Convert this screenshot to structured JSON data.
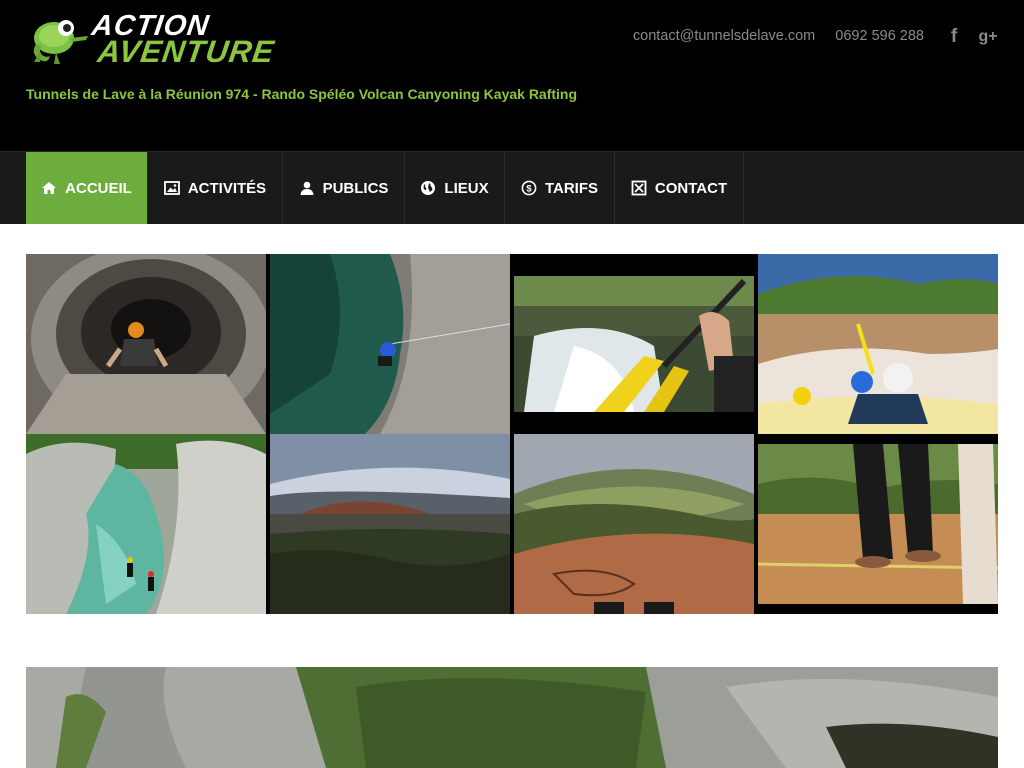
{
  "header": {
    "logo_line1": "ACTION",
    "logo_line2": "AVENTURE",
    "tagline": "Tunnels de Lave à la Réunion 974 - Rando Spéléo Volcan Canyoning Kayak Rafting",
    "email": "contact@tunnelsdelave.com",
    "phone": "0692 596 288",
    "social": [
      {
        "icon": "facebook-icon",
        "glyph": "f"
      },
      {
        "icon": "google-plus-icon",
        "glyph": "g+"
      }
    ]
  },
  "nav": {
    "items": [
      {
        "label": "ACCUEIL",
        "icon": "home-icon",
        "active": true
      },
      {
        "label": "ACTIVITÉS",
        "icon": "image-icon",
        "active": false
      },
      {
        "label": "PUBLICS",
        "icon": "user-icon",
        "active": false
      },
      {
        "label": "LIEUX",
        "icon": "globe-icon",
        "active": false
      },
      {
        "label": "TARIFS",
        "icon": "dollar-icon",
        "active": false
      },
      {
        "label": "CONTACT",
        "icon": "envelope-icon",
        "active": false
      }
    ]
  },
  "gallery": {
    "photos": [
      {
        "subject": "lava-tube-caving"
      },
      {
        "subject": "canyon-pool-abseil"
      },
      {
        "subject": "kayak-waterfall"
      },
      {
        "subject": "rafting-rapids"
      },
      {
        "subject": "canyoning-river-gorge"
      },
      {
        "subject": "volcano-landscape"
      },
      {
        "subject": "abseil-cliff-panorama"
      },
      {
        "subject": "slackline-beach"
      }
    ]
  },
  "banner": {
    "subject": "canyon-cliffs"
  },
  "colors": {
    "accent": "#8cc63f",
    "nav_active": "#6cad3e",
    "header_bg": "#000000",
    "nav_bg": "#1a1a1a"
  }
}
